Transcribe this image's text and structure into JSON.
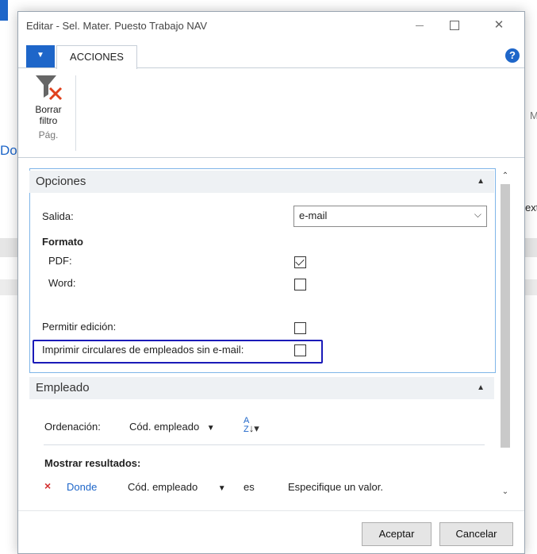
{
  "background": {
    "left_fragments": [
      "Do"
    ],
    "right_fragments": [
      "ext",
      "M"
    ]
  },
  "window": {
    "title": "Editar - Sel. Mater. Puesto Trabajo NAV",
    "minimize_icon": "minimize-icon",
    "maximize_icon": "maximize-icon",
    "close_icon": "close-icon"
  },
  "ribbon": {
    "tab_label": "ACCIONES",
    "help_label": "?",
    "buttons": [
      {
        "label_line1": "Borrar",
        "label_line2": "filtro",
        "icon": "clear-filter-icon"
      }
    ],
    "group_label": "Pág."
  },
  "opciones": {
    "header": "Opciones",
    "salida_label": "Salida:",
    "salida_value": "e-mail",
    "formato_label": "Formato",
    "pdf_label": "PDF:",
    "pdf_checked": true,
    "word_label": "Word:",
    "word_checked": false,
    "permitir_label": "Permitir edición:",
    "permitir_checked": false,
    "imprimir_label": "Imprimir circulares de empleados sin e-mail:",
    "imprimir_checked": false
  },
  "empleado": {
    "header": "Empleado",
    "ordenacion_label": "Ordenación:",
    "ordenacion_value": "Cód. empleado",
    "mostrar_label": "Mostrar resultados:",
    "filter": {
      "remove_icon": "×",
      "where_label": "Donde",
      "field": "Cód. empleado",
      "operator": "es",
      "value_placeholder": "Especifique un valor."
    }
  },
  "footer": {
    "ok_label": "Aceptar",
    "cancel_label": "Cancelar"
  },
  "colors": {
    "accent": "#1e66c9",
    "highlight_border": "#1a1ab8",
    "section_header_bg": "#eef1f4",
    "remove_red": "#d32f2f"
  }
}
